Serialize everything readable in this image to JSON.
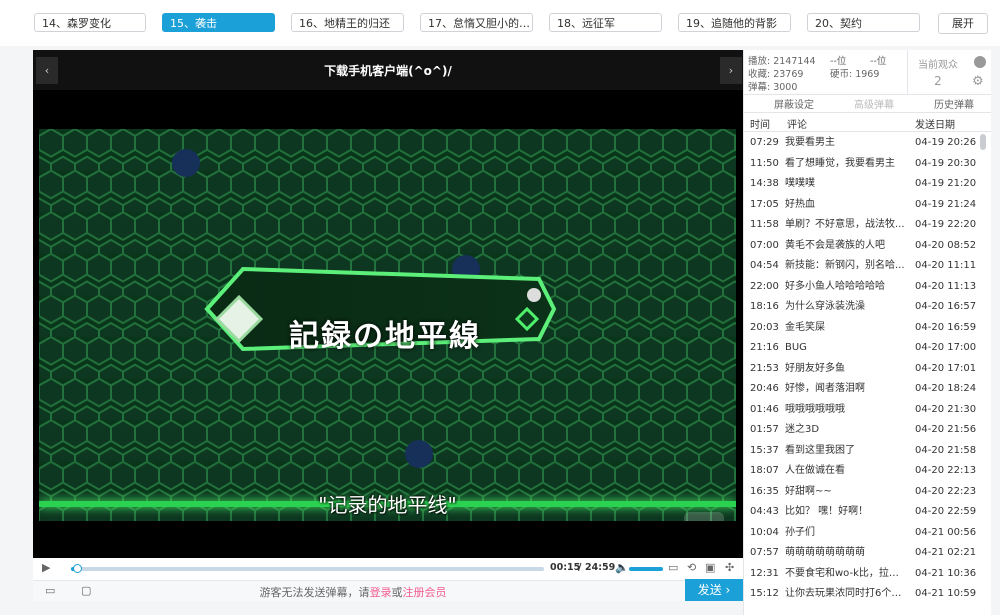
{
  "episodes": [
    {
      "label": "14、森罗变化",
      "active": false
    },
    {
      "label": "15、袭击",
      "active": true
    },
    {
      "label": "16、地精王的归还",
      "active": false
    },
    {
      "label": "17、怠惰又胆小的公...",
      "active": false
    },
    {
      "label": "18、远征军",
      "active": false
    },
    {
      "label": "19、追随他的背影",
      "active": false
    },
    {
      "label": "20、契约",
      "active": false
    }
  ],
  "expand_label": "展开",
  "player": {
    "banner": "下载手机客户端(^o^)/",
    "nav_left": "‹",
    "nav_right": "›",
    "caption_card": "記録の地平線",
    "subtitle": "\"记录的地平线\"",
    "time_current": "00:15",
    "time_sep": "/",
    "time_total": "24:59",
    "progress": 0.01,
    "volume": 1.0
  },
  "send": {
    "msg_prefix": "游客无法发送弹幕，请",
    "login": "登录",
    "or": "或",
    "register": "注册会员",
    "button": "发送 ›"
  },
  "stats": {
    "play_label": "播放: 2147144",
    "fav_label": "收藏: 23769",
    "danmaku_label": "弹幕: 3000",
    "rank1": "--位",
    "rank2": "--位",
    "coins": "硬币: 1969",
    "viewers_label": "当前观众",
    "viewers_count": "2"
  },
  "subtabs": {
    "shield": "屏蔽设定",
    "advanced": "高级弹幕",
    "history": "历史弹幕"
  },
  "list_headers": {
    "time": "时间",
    "comment": "评论",
    "date": "发送日期"
  },
  "comments": [
    {
      "time": "07:29",
      "text": "我要看男主",
      "date": "04-19 20:26"
    },
    {
      "time": "11:50",
      "text": "看了想睡觉，我要看男主",
      "date": "04-19 20:30"
    },
    {
      "time": "14:38",
      "text": "噗噗噗",
      "date": "04-19 21:20"
    },
    {
      "time": "17:05",
      "text": "好热血",
      "date": "04-19 21:24"
    },
    {
      "time": "11:58",
      "text": "单刷？不好意思，战法牧...",
      "date": "04-19 22:20"
    },
    {
      "time": "07:00",
      "text": "黄毛不会是袭族的人吧",
      "date": "04-20 08:52"
    },
    {
      "time": "04:54",
      "text": "新技能：新钢闪，别名哈...",
      "date": "04-20 11:11"
    },
    {
      "time": "22:00",
      "text": "好多小鱼人哈哈哈哈哈",
      "date": "04-20 11:13"
    },
    {
      "time": "18:16",
      "text": "为什么穿泳装洗澡",
      "date": "04-20 16:57"
    },
    {
      "time": "20:03",
      "text": "金毛笑屎",
      "date": "04-20 16:59"
    },
    {
      "time": "21:16",
      "text": "BUG",
      "date": "04-20 17:00"
    },
    {
      "time": "21:53",
      "text": "好朋友好多鱼",
      "date": "04-20 17:01"
    },
    {
      "time": "20:46",
      "text": "好惨，闻者落泪啊",
      "date": "04-20 18:24"
    },
    {
      "time": "01:46",
      "text": "哦哦哦哦哦哦",
      "date": "04-20 21:30"
    },
    {
      "time": "01:57",
      "text": "迷之3D",
      "date": "04-20 21:56"
    },
    {
      "time": "15:37",
      "text": "看到这里我困了",
      "date": "04-20 21:58"
    },
    {
      "time": "18:07",
      "text": "人在做诚在看",
      "date": "04-20 22:13"
    },
    {
      "time": "16:35",
      "text": "好甜啊~~",
      "date": "04-20 22:23"
    },
    {
      "time": "04:43",
      "text": "比如？ 嘿！好啊！",
      "date": "04-20 22:59"
    },
    {
      "time": "10:04",
      "text": "孙子们",
      "date": "04-21 00:56"
    },
    {
      "time": "07:57",
      "text": "萌萌萌萌萌萌萌萌",
      "date": "04-21 02:21"
    },
    {
      "time": "12:31",
      "text": "不要食宅和wo-k比，拉神...",
      "date": "04-21 10:36"
    },
    {
      "time": "15:12",
      "text": "让你去玩果浓同时打6个小...",
      "date": "04-21 10:59"
    }
  ],
  "colors": {
    "accent": "#1ba0d8",
    "link": "#f25d8e",
    "green": "#2bd24f"
  },
  "icons": {
    "play": "play-icon",
    "volume": "volume-icon",
    "settings": "gear-icon"
  }
}
